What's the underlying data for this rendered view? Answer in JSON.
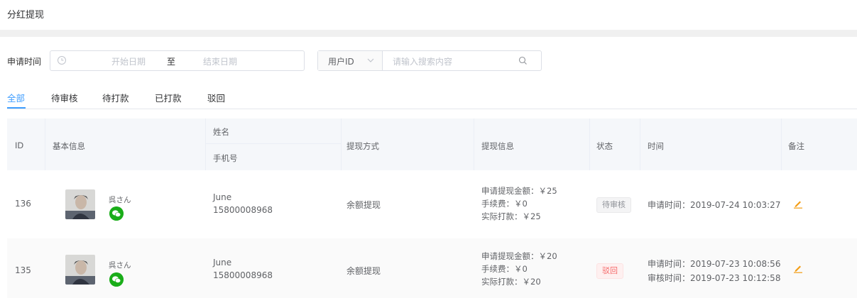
{
  "page": {
    "title": "分红提现"
  },
  "filter": {
    "date_label": "申请时间",
    "start_placeholder": "开始日期",
    "separator": "至",
    "end_placeholder": "结束日期",
    "search_field": "用户ID",
    "search_placeholder": "请输入搜索内容"
  },
  "tabs": [
    {
      "label": "全部",
      "active": true
    },
    {
      "label": "待审核"
    },
    {
      "label": "待打款"
    },
    {
      "label": "已打款"
    },
    {
      "label": "驳回"
    }
  ],
  "table": {
    "headers": {
      "id": "ID",
      "basic": "基本信息",
      "name": "姓名",
      "phone": "手机号",
      "method": "提现方式",
      "info": "提现信息",
      "status": "状态",
      "time": "时间",
      "remark": "备注"
    },
    "rows": [
      {
        "id": "136",
        "nick": "呉さん",
        "name": "June",
        "phone": "15800008968",
        "method": "余额提现",
        "apply_amount": "申请提现金额：￥25",
        "fee": "手续费：￥0",
        "actual": "实际打款：￥25",
        "status": "待审核",
        "apply_time": "申请时间：2019-07-24 10:03:27"
      },
      {
        "id": "135",
        "nick": "呉さん",
        "name": "June",
        "phone": "15800008968",
        "method": "余额提现",
        "apply_amount": "申请提现金额：￥20",
        "fee": "手续费：￥0",
        "actual": "实际打款：￥20",
        "status": "驳回",
        "apply_time": "申请时间：2019-07-23 10:08:56",
        "review_time": "审核时间：2019-07-23 10:12:58"
      }
    ]
  },
  "colors": {
    "accent": "#409eff",
    "wechat": "#1aad19",
    "edit": "#f39c12",
    "reject": "#f56c6c"
  }
}
